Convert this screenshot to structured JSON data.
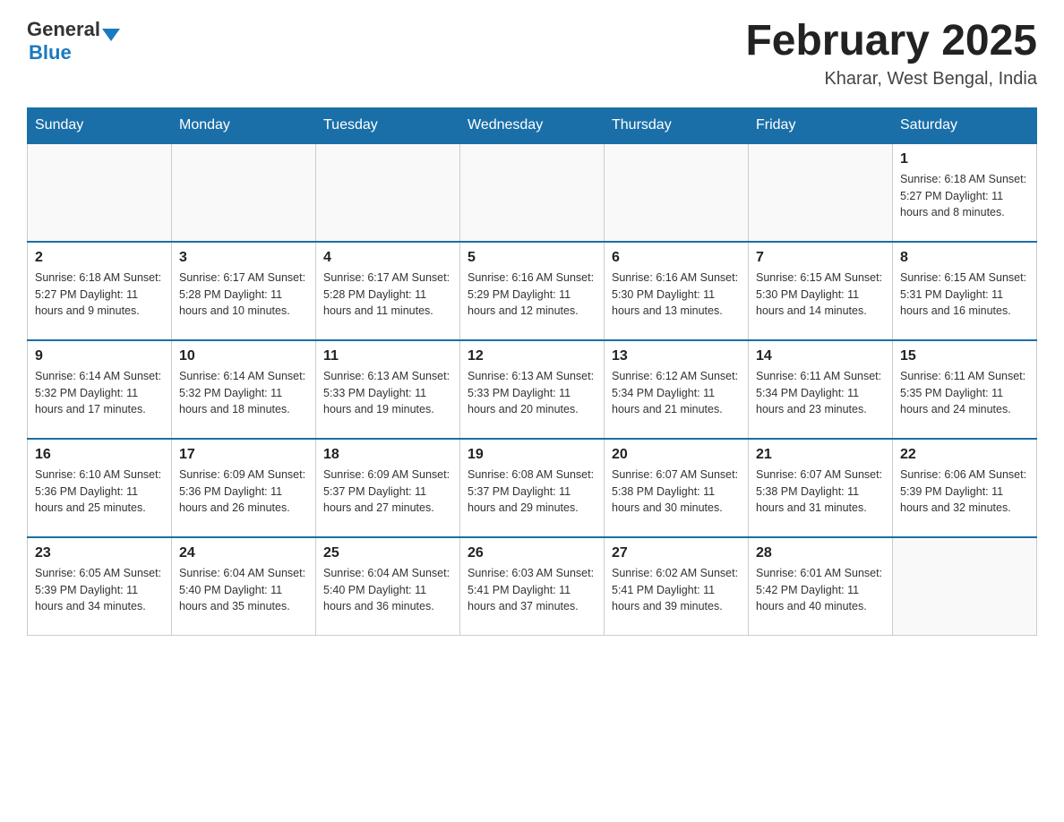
{
  "header": {
    "logo_general": "General",
    "logo_blue": "Blue",
    "title": "February 2025",
    "subtitle": "Kharar, West Bengal, India"
  },
  "weekdays": [
    "Sunday",
    "Monday",
    "Tuesday",
    "Wednesday",
    "Thursday",
    "Friday",
    "Saturday"
  ],
  "weeks": [
    [
      {
        "day": "",
        "info": ""
      },
      {
        "day": "",
        "info": ""
      },
      {
        "day": "",
        "info": ""
      },
      {
        "day": "",
        "info": ""
      },
      {
        "day": "",
        "info": ""
      },
      {
        "day": "",
        "info": ""
      },
      {
        "day": "1",
        "info": "Sunrise: 6:18 AM\nSunset: 5:27 PM\nDaylight: 11 hours and 8 minutes."
      }
    ],
    [
      {
        "day": "2",
        "info": "Sunrise: 6:18 AM\nSunset: 5:27 PM\nDaylight: 11 hours and 9 minutes."
      },
      {
        "day": "3",
        "info": "Sunrise: 6:17 AM\nSunset: 5:28 PM\nDaylight: 11 hours and 10 minutes."
      },
      {
        "day": "4",
        "info": "Sunrise: 6:17 AM\nSunset: 5:28 PM\nDaylight: 11 hours and 11 minutes."
      },
      {
        "day": "5",
        "info": "Sunrise: 6:16 AM\nSunset: 5:29 PM\nDaylight: 11 hours and 12 minutes."
      },
      {
        "day": "6",
        "info": "Sunrise: 6:16 AM\nSunset: 5:30 PM\nDaylight: 11 hours and 13 minutes."
      },
      {
        "day": "7",
        "info": "Sunrise: 6:15 AM\nSunset: 5:30 PM\nDaylight: 11 hours and 14 minutes."
      },
      {
        "day": "8",
        "info": "Sunrise: 6:15 AM\nSunset: 5:31 PM\nDaylight: 11 hours and 16 minutes."
      }
    ],
    [
      {
        "day": "9",
        "info": "Sunrise: 6:14 AM\nSunset: 5:32 PM\nDaylight: 11 hours and 17 minutes."
      },
      {
        "day": "10",
        "info": "Sunrise: 6:14 AM\nSunset: 5:32 PM\nDaylight: 11 hours and 18 minutes."
      },
      {
        "day": "11",
        "info": "Sunrise: 6:13 AM\nSunset: 5:33 PM\nDaylight: 11 hours and 19 minutes."
      },
      {
        "day": "12",
        "info": "Sunrise: 6:13 AM\nSunset: 5:33 PM\nDaylight: 11 hours and 20 minutes."
      },
      {
        "day": "13",
        "info": "Sunrise: 6:12 AM\nSunset: 5:34 PM\nDaylight: 11 hours and 21 minutes."
      },
      {
        "day": "14",
        "info": "Sunrise: 6:11 AM\nSunset: 5:34 PM\nDaylight: 11 hours and 23 minutes."
      },
      {
        "day": "15",
        "info": "Sunrise: 6:11 AM\nSunset: 5:35 PM\nDaylight: 11 hours and 24 minutes."
      }
    ],
    [
      {
        "day": "16",
        "info": "Sunrise: 6:10 AM\nSunset: 5:36 PM\nDaylight: 11 hours and 25 minutes."
      },
      {
        "day": "17",
        "info": "Sunrise: 6:09 AM\nSunset: 5:36 PM\nDaylight: 11 hours and 26 minutes."
      },
      {
        "day": "18",
        "info": "Sunrise: 6:09 AM\nSunset: 5:37 PM\nDaylight: 11 hours and 27 minutes."
      },
      {
        "day": "19",
        "info": "Sunrise: 6:08 AM\nSunset: 5:37 PM\nDaylight: 11 hours and 29 minutes."
      },
      {
        "day": "20",
        "info": "Sunrise: 6:07 AM\nSunset: 5:38 PM\nDaylight: 11 hours and 30 minutes."
      },
      {
        "day": "21",
        "info": "Sunrise: 6:07 AM\nSunset: 5:38 PM\nDaylight: 11 hours and 31 minutes."
      },
      {
        "day": "22",
        "info": "Sunrise: 6:06 AM\nSunset: 5:39 PM\nDaylight: 11 hours and 32 minutes."
      }
    ],
    [
      {
        "day": "23",
        "info": "Sunrise: 6:05 AM\nSunset: 5:39 PM\nDaylight: 11 hours and 34 minutes."
      },
      {
        "day": "24",
        "info": "Sunrise: 6:04 AM\nSunset: 5:40 PM\nDaylight: 11 hours and 35 minutes."
      },
      {
        "day": "25",
        "info": "Sunrise: 6:04 AM\nSunset: 5:40 PM\nDaylight: 11 hours and 36 minutes."
      },
      {
        "day": "26",
        "info": "Sunrise: 6:03 AM\nSunset: 5:41 PM\nDaylight: 11 hours and 37 minutes."
      },
      {
        "day": "27",
        "info": "Sunrise: 6:02 AM\nSunset: 5:41 PM\nDaylight: 11 hours and 39 minutes."
      },
      {
        "day": "28",
        "info": "Sunrise: 6:01 AM\nSunset: 5:42 PM\nDaylight: 11 hours and 40 minutes."
      },
      {
        "day": "",
        "info": ""
      }
    ]
  ]
}
